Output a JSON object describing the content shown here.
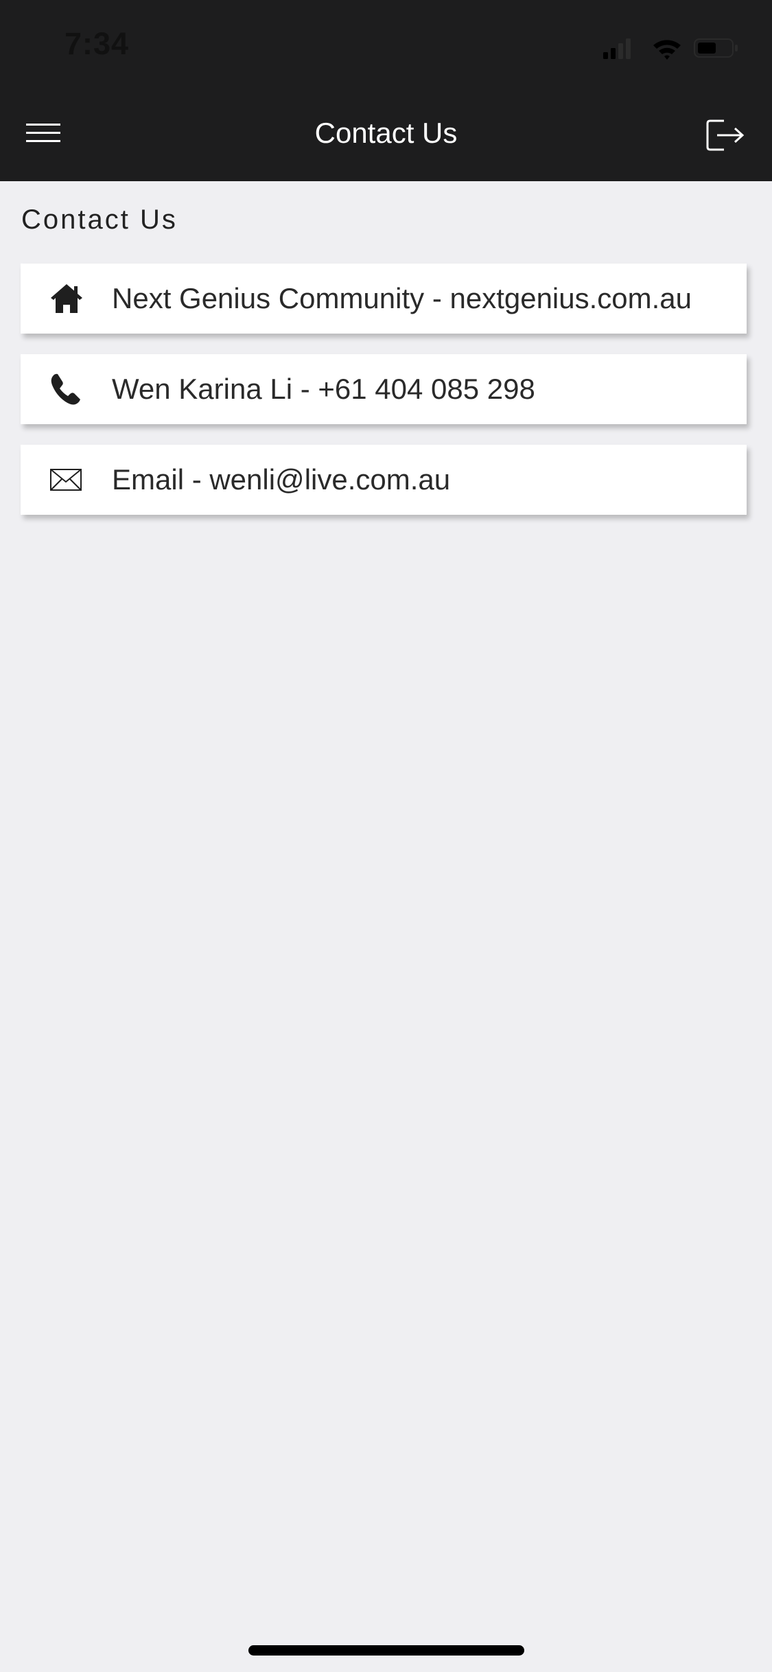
{
  "status_bar": {
    "time": "7:34",
    "icons": [
      "cellular-signal-icon",
      "wifi-icon",
      "battery-icon"
    ],
    "battery_level": 0.5
  },
  "nav": {
    "title": "Contact Us",
    "left_icon": "hamburger-menu-icon",
    "right_icon": "logout-icon"
  },
  "section": {
    "title": "Contact Us"
  },
  "contacts": [
    {
      "icon": "home-icon",
      "text": "Next Genius Community - nextgenius.com.au"
    },
    {
      "icon": "phone-icon",
      "text": "Wen Karina Li - +61 404 085 298"
    },
    {
      "icon": "mail-icon",
      "text": "Email - wenli@live.com.au"
    }
  ],
  "colors": {
    "header_bg": "#1d1d1e",
    "page_bg": "#efeff2",
    "card_bg": "#ffffff",
    "text": "#2a2a2a"
  }
}
